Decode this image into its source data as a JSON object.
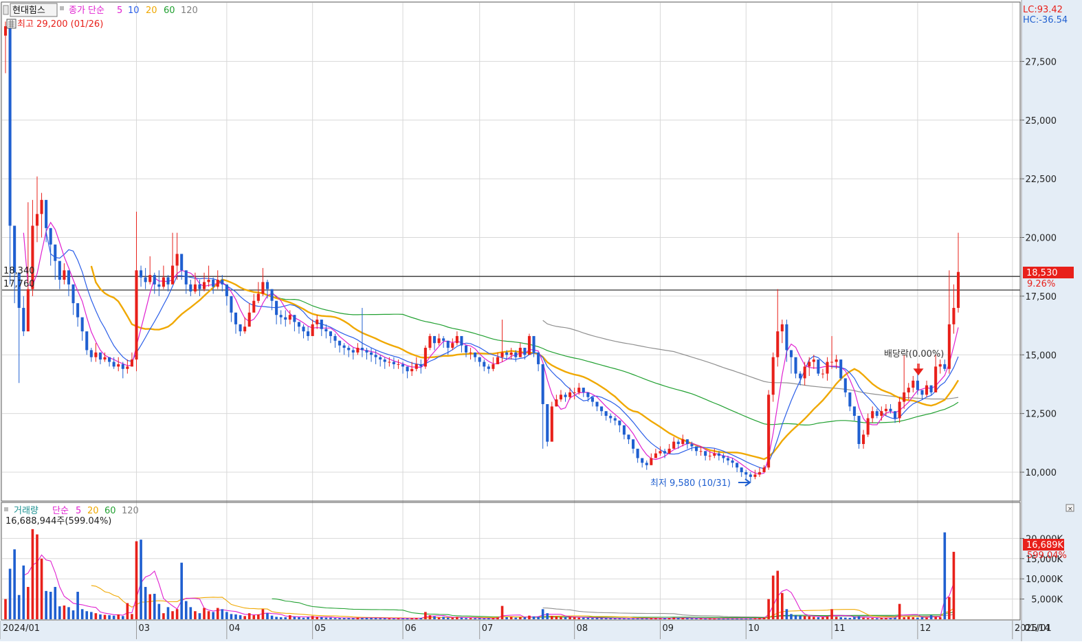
{
  "header": {
    "stock_name": "현대힘스",
    "ma_prefix": "종가 단순",
    "ma_periods": [
      "5",
      "10",
      "20",
      "60",
      "120"
    ],
    "high_label": "최고 29,200 (01/26)",
    "lc": "LC:93.42",
    "hc": "HC:-36.54",
    "close_tag": "18,530",
    "close_change": "9.26%",
    "line_label_1": "18,340",
    "line_label_2": "17,760",
    "dividend_label": "배당락(0.00%)",
    "low_label": "최저 9,580 (10/31)"
  },
  "volume_header": {
    "title": "거래량",
    "ma_prefix": "단순",
    "ma_periods": [
      "5",
      "20",
      "60",
      "120"
    ],
    "value_text": "16,688,944주(599.04%)",
    "volume_tag": "16,689K",
    "volume_change": "599.04%"
  },
  "colors": {
    "up": "#e8201a",
    "down": "#1f5fd0",
    "ma5": "#e020d0",
    "ma10": "#2a5ee8",
    "ma20": "#f0a800",
    "ma60": "#20a030",
    "ma120": "#909090",
    "grid": "#d8d8d8",
    "axis_bg": "#e4edf6"
  },
  "chart_data": [
    {
      "type": "candlestick",
      "title": "",
      "ylim": [
        8800,
        30000
      ],
      "y_ticks": [
        "10,000",
        "12,500",
        "15,000",
        "17,500",
        "20,000",
        "22,500",
        "25,000",
        "27,500"
      ],
      "x_tick_labels": [
        "2024/01",
        "03",
        "04",
        "05",
        "06",
        "07",
        "08",
        "09",
        "10",
        "11",
        "12",
        "2025/01",
        "01/14"
      ],
      "horizontal_lines": [
        18340,
        17760
      ],
      "closes": [
        29000,
        20500,
        18500,
        17000,
        16000,
        17800,
        20500,
        21000,
        21600,
        20400,
        19700,
        19000,
        18200,
        18600,
        18000,
        17200,
        16600,
        16000,
        15200,
        14900,
        15100,
        14800,
        14900,
        14700,
        14500,
        14600,
        14400,
        14500,
        14800,
        18600,
        18300,
        18100,
        18400,
        18000,
        17900,
        18300,
        18000,
        18800,
        19300,
        18600,
        18000,
        17700,
        18000,
        17800,
        18100,
        18200,
        17900,
        18200,
        18000,
        17500,
        16800,
        16300,
        16000,
        16200,
        16800,
        17300,
        17600,
        18100,
        17800,
        17300,
        16700,
        16600,
        16500,
        16700,
        16400,
        16200,
        16000,
        15800,
        16300,
        16500,
        16100,
        16000,
        15800,
        15600,
        15400,
        15300,
        15200,
        15100,
        15300,
        15200,
        15100,
        15000,
        14900,
        14800,
        14700,
        14700,
        14600,
        14600,
        14500,
        14300,
        14400,
        14600,
        14500,
        15300,
        15800,
        15500,
        15700,
        15600,
        15300,
        15500,
        15800,
        15400,
        15100,
        15100,
        14900,
        14700,
        14500,
        14400,
        14600,
        14900,
        15100,
        15000,
        15100,
        14900,
        15300,
        15000,
        15800,
        15100,
        14600,
        12900,
        11300,
        12800,
        13100,
        13300,
        13200,
        13400,
        13400,
        13600,
        13400,
        13200,
        13000,
        12800,
        12600,
        12400,
        12300,
        12200,
        12000,
        11600,
        11400,
        11000,
        10600,
        10400,
        10300,
        10600,
        10800,
        10900,
        10800,
        11000,
        11300,
        11200,
        11400,
        11200,
        11100,
        10900,
        10900,
        10700,
        10700,
        10800,
        10700,
        10600,
        10500,
        10400,
        10200,
        10000,
        9900,
        9800,
        9900,
        10000,
        10200,
        13300,
        14900,
        16000,
        16300,
        15200,
        14900,
        14200,
        14000,
        14500,
        14700,
        14800,
        14200,
        14200,
        14700,
        14700,
        14800,
        14000,
        13400,
        12800,
        12400,
        11200,
        11600,
        12300,
        12600,
        12400,
        12600,
        12700,
        12600,
        12300,
        13000,
        13400,
        13600,
        13900,
        13500,
        13300,
        13700,
        13400,
        14500,
        14600,
        14400,
        16300,
        17000,
        18530
      ],
      "highs": [
        29200,
        21800,
        19500,
        18200,
        17500,
        21500,
        21600,
        22600,
        21900,
        21300,
        20400,
        19300,
        18800,
        18900,
        18500,
        17900,
        16900,
        16400,
        15700,
        15300,
        15500,
        15100,
        15100,
        14900,
        14900,
        14900,
        14700,
        14800,
        15100,
        21100,
        18800,
        18700,
        19200,
        18500,
        18600,
        18800,
        18400,
        20200,
        20200,
        19000,
        18400,
        18200,
        18500,
        18200,
        18500,
        18800,
        18300,
        18600,
        18400,
        17800,
        17000,
        16500,
        16300,
        16600,
        17200,
        17600,
        18100,
        18700,
        18200,
        17600,
        16900,
        16900,
        16900,
        16900,
        16700,
        16400,
        16300,
        16200,
        16500,
        16700,
        16300,
        16300,
        16000,
        15900,
        15600,
        15500,
        15400,
        15300,
        15500,
        17000,
        15300,
        15300,
        15200,
        15000,
        14900,
        14900,
        14900,
        14800,
        14700,
        14500,
        14700,
        14900,
        14800,
        15400,
        15900,
        15800,
        15900,
        15800,
        15600,
        15700,
        16000,
        15600,
        15300,
        15300,
        15100,
        14900,
        14800,
        14600,
        14900,
        15100,
        16500,
        15200,
        15300,
        15200,
        15500,
        15300,
        15900,
        15600,
        15100,
        13500,
        12800,
        13000,
        13300,
        13500,
        13400,
        13600,
        13600,
        13800,
        13600,
        13400,
        13200,
        13000,
        12800,
        12600,
        12500,
        12400,
        12200,
        11800,
        11600,
        11200,
        10800,
        10600,
        10500,
        10800,
        11000,
        11100,
        11000,
        11200,
        11500,
        11400,
        11600,
        11400,
        11300,
        11100,
        11100,
        10900,
        10900,
        11000,
        10900,
        10800,
        10700,
        10600,
        10400,
        10200,
        10100,
        10000,
        10100,
        10200,
        10300,
        13500,
        15100,
        17800,
        16500,
        16500,
        15100,
        14500,
        14300,
        14700,
        14900,
        15000,
        14700,
        14400,
        14900,
        15800,
        15000,
        14500,
        13600,
        13000,
        12600,
        11600,
        11800,
        12500,
        12800,
        12700,
        12800,
        12900,
        12900,
        12500,
        13200,
        15000,
        13800,
        14100,
        14200,
        13500,
        13900,
        13700,
        15000,
        14800,
        14800,
        18600,
        18000,
        20200
      ],
      "lows": [
        27000,
        18000,
        17200,
        13800,
        15800,
        16000,
        17500,
        19800,
        20000,
        19800,
        18800,
        18200,
        17800,
        18000,
        17500,
        16700,
        16200,
        15600,
        15000,
        14700,
        14700,
        14600,
        14700,
        14500,
        14400,
        14300,
        14000,
        14200,
        14500,
        14300,
        17900,
        17800,
        18000,
        17600,
        17500,
        17800,
        17700,
        18300,
        18200,
        18200,
        17600,
        17500,
        17600,
        17500,
        17700,
        17900,
        17600,
        17800,
        17700,
        17100,
        16400,
        15900,
        15800,
        15900,
        16500,
        16900,
        17200,
        17500,
        17400,
        16900,
        16300,
        16300,
        16200,
        16300,
        16000,
        15900,
        15700,
        15600,
        15900,
        16100,
        15800,
        15700,
        15500,
        15300,
        15100,
        15000,
        14900,
        14800,
        15000,
        14900,
        14800,
        14700,
        14600,
        14500,
        14400,
        14500,
        14400,
        14400,
        14200,
        14000,
        14100,
        14300,
        14200,
        14400,
        15200,
        15200,
        15400,
        15300,
        15000,
        15200,
        15400,
        15100,
        14900,
        14800,
        14700,
        14500,
        14300,
        14200,
        14300,
        14600,
        14700,
        14800,
        14800,
        14700,
        14900,
        14800,
        15400,
        14900,
        14300,
        11000,
        11100,
        12300,
        12800,
        13000,
        13000,
        13100,
        13100,
        13300,
        13200,
        13000,
        12800,
        12600,
        12400,
        12200,
        12100,
        12000,
        11700,
        11400,
        11200,
        10800,
        10400,
        10200,
        10100,
        10300,
        10600,
        10700,
        10600,
        10800,
        11000,
        11000,
        11100,
        11000,
        10900,
        10700,
        10700,
        10500,
        10500,
        10600,
        10500,
        10400,
        10300,
        10200,
        10000,
        9800,
        9700,
        9580,
        9700,
        9800,
        10000,
        10100,
        13000,
        14500,
        15500,
        14700,
        14200,
        14000,
        13700,
        13700,
        14100,
        14400,
        14100,
        14000,
        13900,
        14400,
        14400,
        13900,
        13200,
        12600,
        12200,
        11000,
        11000,
        11500,
        12100,
        12300,
        12200,
        12400,
        12500,
        12100,
        12100,
        12700,
        13100,
        13400,
        13300,
        13100,
        13200,
        13300,
        13400,
        14200,
        14300,
        14200,
        15900,
        16800
      ]
    },
    {
      "type": "bar",
      "title": "",
      "ylim": [
        0,
        25000
      ],
      "unit": "K",
      "y_ticks": [
        "5,000K",
        "10,000K",
        "15,000K",
        "20,000K"
      ],
      "values": [
        5000,
        12500,
        17300,
        6000,
        13300,
        8000,
        22300,
        21000,
        15000,
        7000,
        6800,
        8000,
        3200,
        3400,
        3000,
        2200,
        6800,
        2500,
        2000,
        1800,
        1500,
        1200,
        1100,
        1000,
        900,
        1200,
        800,
        4000,
        1300,
        19300,
        19700,
        8000,
        6200,
        6300,
        3800,
        1500,
        3000,
        2000,
        2500,
        14000,
        4500,
        3000,
        2000,
        1500,
        2800,
        2000,
        1800,
        2800,
        2500,
        1800,
        1300,
        1200,
        1000,
        800,
        1500,
        1000,
        1200,
        2500,
        1500,
        900,
        600,
        500,
        500,
        1000,
        600,
        500,
        400,
        500,
        800,
        600,
        500,
        400,
        400,
        300,
        300,
        300,
        300,
        250,
        400,
        300,
        350,
        300,
        300,
        250,
        250,
        250,
        200,
        250,
        200,
        200,
        250,
        300,
        300,
        1800,
        1000,
        700,
        500,
        600,
        400,
        400,
        600,
        400,
        300,
        300,
        250,
        250,
        200,
        250,
        300,
        400,
        3300,
        500,
        600,
        400,
        500,
        500,
        900,
        700,
        600,
        2500,
        1500,
        800,
        700,
        600,
        500,
        600,
        500,
        400,
        400,
        350,
        300,
        300,
        250,
        250,
        250,
        200,
        200,
        200,
        200,
        200,
        200,
        200,
        200,
        250,
        250,
        200,
        250,
        300,
        400,
        300,
        300,
        250,
        200,
        200,
        200,
        150,
        150,
        150,
        150,
        150,
        150,
        150,
        150,
        150,
        150,
        200,
        250,
        300,
        400,
        5000,
        10800,
        12000,
        6500,
        2500,
        1300,
        1000,
        900,
        800,
        700,
        600,
        500,
        500,
        700,
        2500,
        600,
        500,
        400,
        350,
        600,
        700,
        400,
        300,
        300,
        250,
        350,
        300,
        300,
        400,
        3800,
        500,
        600,
        500,
        400,
        500,
        400,
        1000,
        600,
        500,
        21500,
        5500,
        16689
      ]
    }
  ]
}
